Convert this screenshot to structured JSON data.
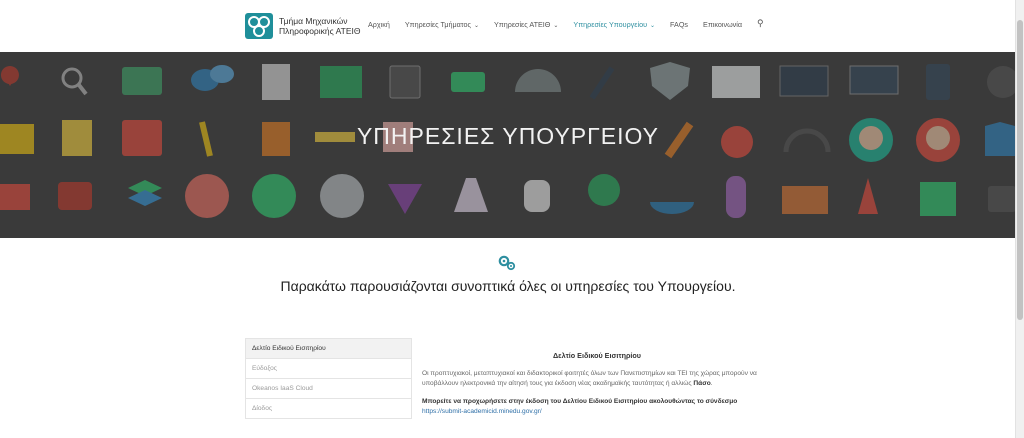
{
  "brand": {
    "line1": "Τμήμα Μηχανικών",
    "line2": "Πληροφορικής ΑΤΕΙΘ"
  },
  "nav": [
    {
      "label": "Αρχική",
      "dropdown": false,
      "active": false
    },
    {
      "label": "Υπηρεσίες Τμήματος",
      "dropdown": true,
      "active": false
    },
    {
      "label": "Υπηρεσίες ΑΤΕΙΘ",
      "dropdown": true,
      "active": false
    },
    {
      "label": "Υπηρεσίες Υπουργείου",
      "dropdown": true,
      "active": true
    },
    {
      "label": "FAQs",
      "dropdown": false,
      "active": false
    },
    {
      "label": "Επικοινωνία",
      "dropdown": false,
      "active": false
    }
  ],
  "hero": {
    "title": "ΥΠΗΡΕΣΙΕΣ ΥΠΟΥΡΓΕΙΟΥ"
  },
  "headline": "Παρακάτω παρουσιάζονται συνοπτικά όλες οι υπηρεσίες του Υπουργείου.",
  "tabs": [
    "Δελτίο Ειδικού Εισιτηρίου",
    "Εύδοξος",
    "Okeanos IaaS Cloud",
    "Δίοδος"
  ],
  "content": {
    "title": "Δελτίο Ειδικού Εισιτηρίου",
    "p1": "Οι προπτυχιακοί, μεταπτυχιακοί και διδακτορικοί φοιτητές  όλων των Πανεπιστημίων και ΤΕΙ της χώρας μπορούν να υποβάλλουν ηλεκτρονικά την αίτησή τους για έκδοση νέας ακαδημαϊκής ταυτότητας ή αλλιώς",
    "p1_bold": "Πάσο",
    "p2": "Μπορείτε να προχωρήσετε στην έκδοση του Δελτίου Ειδικού Εισιτηρίου ακολουθώντας το σύνδεσμο",
    "link": "https://submit-academicid.minedu.gov.gr/"
  },
  "colors": {
    "accent": "#2e8fa0",
    "hero_bg": "#3a3a3a"
  }
}
